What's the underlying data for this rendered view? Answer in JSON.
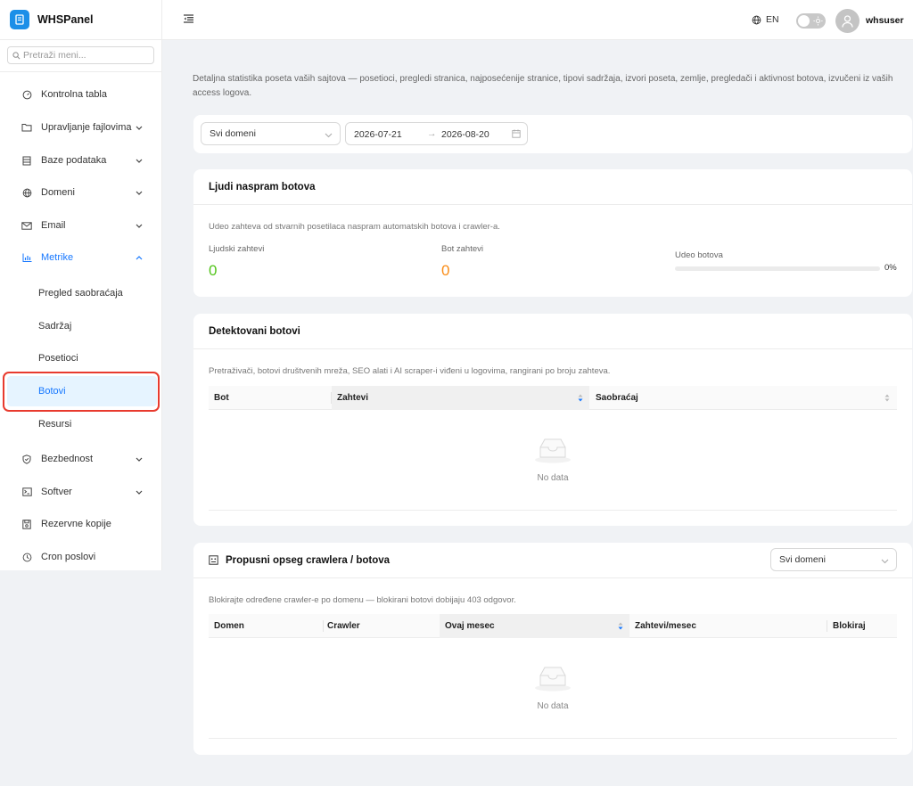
{
  "brand": {
    "name": "WHSPanel"
  },
  "sidebar": {
    "search_placeholder": "Pretraži meni...",
    "items": [
      {
        "label": "Kontrolna tabla",
        "icon": "dashboard-icon"
      },
      {
        "label": "Upravljanje fajlovima",
        "icon": "folder-icon",
        "expandable": true
      },
      {
        "label": "Baze podataka",
        "icon": "database-icon",
        "expandable": true
      },
      {
        "label": "Domeni",
        "icon": "globe-icon",
        "expandable": true
      },
      {
        "label": "Email",
        "icon": "mail-icon",
        "expandable": true
      },
      {
        "label": "Metrike",
        "icon": "chart-icon",
        "expandable": true,
        "expanded": true
      },
      {
        "label": "Bezbednost",
        "icon": "shield-icon",
        "expandable": true
      },
      {
        "label": "Softver",
        "icon": "terminal-icon",
        "expandable": true
      },
      {
        "label": "Rezervne kopije",
        "icon": "save-icon"
      },
      {
        "label": "Cron poslovi",
        "icon": "clock-icon"
      }
    ],
    "metrics_sub": [
      "Pregled saobraćaja",
      "Sadržaj",
      "Posetioci",
      "Botovi",
      "Resursi"
    ],
    "selected_sub": "Botovi"
  },
  "header": {
    "language": "EN",
    "username": "whsuser"
  },
  "intro": "Detaljna statistika poseta vaših sajtova — posetioci, pregledi stranica, najposećenije stranice, tipovi sadržaja, izvori poseta, zemlje, pregledači i aktivnost botova, izvučeni iz vaših access logova.",
  "filters": {
    "domain": "Svi domeni",
    "date_from": "2026-07-21",
    "date_to": "2026-08-20"
  },
  "humans_vs_bots": {
    "title": "Ljudi naspram botova",
    "description": "Udeo zahteva od stvarnih posetilaca naspram automatskih botova i crawler-a.",
    "human_label": "Ljudski zahtevi",
    "human_value": "0",
    "bot_label": "Bot zahtevi",
    "bot_value": "0",
    "share_label": "Udeo botova",
    "share_value": "0%",
    "share_fraction": 0
  },
  "detected_bots": {
    "title": "Detektovani botovi",
    "description": "Pretraživači, botovi društvenih mreža, SEO alati i AI scraper-i viđeni u logovima, rangirani po broju zahteva.",
    "columns": [
      "Bot",
      "Zahtevi",
      "Saobraćaj"
    ],
    "empty_text": "No data"
  },
  "crawler_bandwidth": {
    "title": "Propusni opseg crawlera / botova",
    "domain_select": "Svi domeni",
    "description": "Blokirajte određene crawler-e po domenu — blokirani botovi dobijaju 403 odgovor.",
    "columns": [
      "Domen",
      "Crawler",
      "Ovaj mesec",
      "Zahtevi/mesec",
      "Blokiraj"
    ],
    "empty_text": "No data"
  },
  "colors": {
    "accent": "#1677ff",
    "human_value": "#52c41a",
    "bot_value": "#fa8c16",
    "highlight": "#e83a2e"
  }
}
